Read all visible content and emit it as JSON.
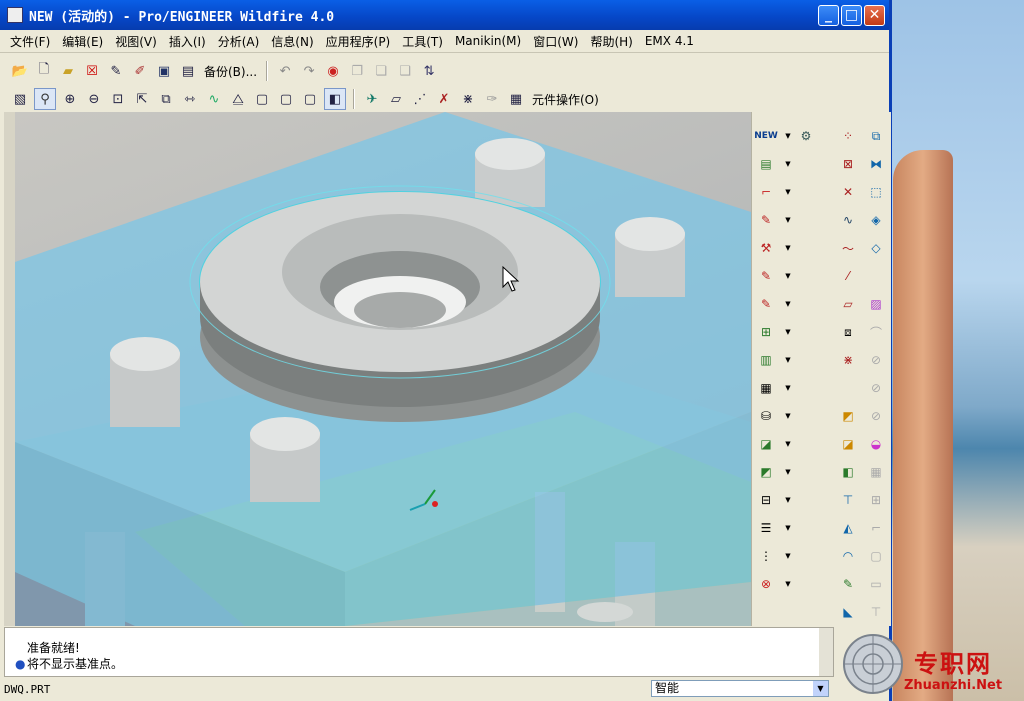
{
  "window": {
    "title": "NEW (活动的) - Pro/ENGINEER Wildfire 4.0",
    "min_glyph": "_",
    "max_glyph": "□",
    "close_glyph": "✕"
  },
  "menubar": [
    {
      "label": "文件(F)"
    },
    {
      "label": "编辑(E)"
    },
    {
      "label": "视图(V)"
    },
    {
      "label": "插入(I)"
    },
    {
      "label": "分析(A)"
    },
    {
      "label": "信息(N)"
    },
    {
      "label": "应用程序(P)"
    },
    {
      "label": "工具(T)"
    },
    {
      "label": "Manikin(M)"
    },
    {
      "label": "窗口(W)"
    },
    {
      "label": "帮助(H)"
    },
    {
      "label": "EMX 4.1"
    }
  ],
  "toolbar1": {
    "backup_label": "备份(B)..."
  },
  "toolbar2": {
    "component_ops_label": "元件操作(O)"
  },
  "side_new_label": "NEW",
  "messages": {
    "line1": "准备就绪!",
    "line2": "将不显示基准点。"
  },
  "status": {
    "filename": "DWQ.PRT",
    "filter_value": "智能"
  },
  "watermark": {
    "text": "专职网",
    "sub": "Zhuanzhi.Net"
  },
  "colors": {
    "titlebar": "#0646c6",
    "mold_blue": "#7cc6e6",
    "mold_green": "#9fd08a",
    "part_gray": "#c7c9c8",
    "watermark_red": "#cc1111"
  }
}
